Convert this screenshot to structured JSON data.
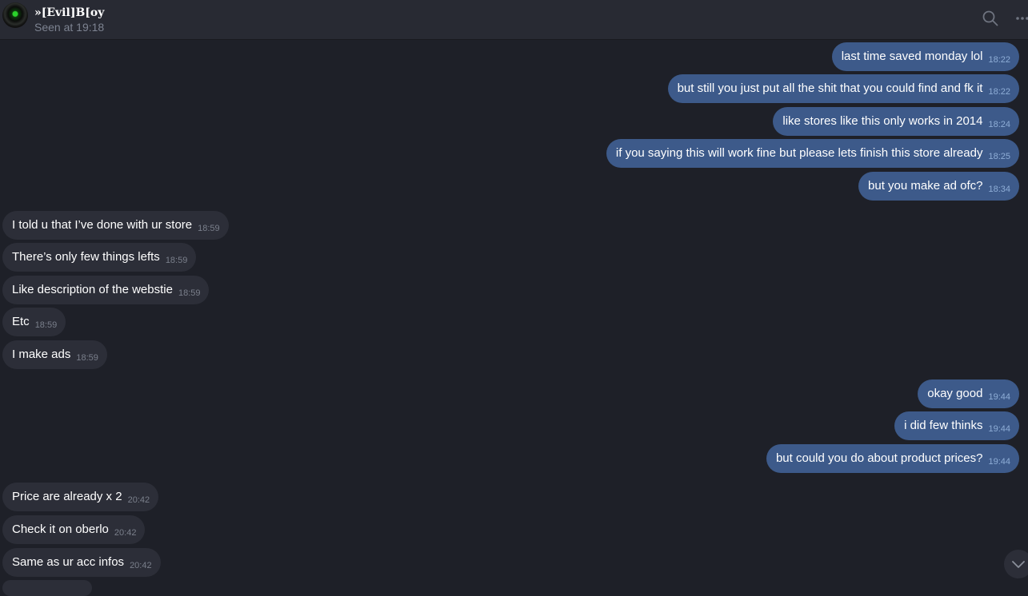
{
  "header": {
    "name": "»[Evil]B[oy",
    "status": "Seen at 19:18",
    "search_icon": "search-icon",
    "more_icon": "more-options-icon"
  },
  "colors": {
    "background": "#1e2028",
    "header": "#282a33",
    "outgoing_bubble": "#3d5a8a",
    "incoming_bubble": "#2c2e38",
    "outgoing_time": "#8eadd6",
    "incoming_time": "#7a7f8b"
  },
  "messages": [
    {
      "direction": "out",
      "text": "last time saved monday lol",
      "time": "18:22"
    },
    {
      "direction": "out",
      "text": "but still you just put all the shit that you could find and fk it",
      "time": "18:22"
    },
    {
      "direction": "out",
      "text": "like stores like this only works in 2014",
      "time": "18:24"
    },
    {
      "direction": "out",
      "text": "if you saying this will work fine but please lets finish this store already",
      "time": "18:25"
    },
    {
      "direction": "out",
      "text": "but you make ad ofc?",
      "time": "18:34"
    },
    {
      "direction": "in",
      "text": "I told u that I’ve done with ur store",
      "time": "18:59"
    },
    {
      "direction": "in",
      "text": "There’s only few things lefts",
      "time": "18:59"
    },
    {
      "direction": "in",
      "text": "Like description of the webstie",
      "time": "18:59"
    },
    {
      "direction": "in",
      "text": "Etc",
      "time": "18:59"
    },
    {
      "direction": "in",
      "text": "I make ads",
      "time": "18:59"
    },
    {
      "direction": "out",
      "text": "okay good",
      "time": "19:44"
    },
    {
      "direction": "out",
      "text": "i did few thinks",
      "time": "19:44"
    },
    {
      "direction": "out",
      "text": "but could you do about product prices?",
      "time": "19:44"
    },
    {
      "direction": "in",
      "text": "Price are already x 2",
      "time": "20:42"
    },
    {
      "direction": "in",
      "text": "Check it on oberlo",
      "time": "20:42"
    },
    {
      "direction": "in",
      "text": "Same as ur acc infos",
      "time": "20:42"
    }
  ],
  "scroll_button_icon": "chevron-down-icon"
}
